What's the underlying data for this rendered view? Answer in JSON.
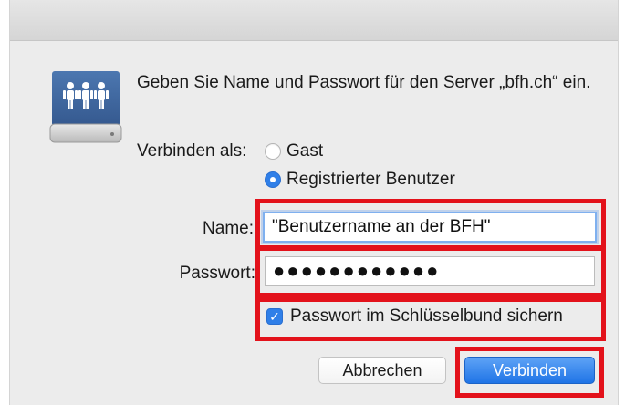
{
  "dialog": {
    "prompt": "Geben Sie Name und Passwort für den Server „bfh.ch“ ein.",
    "connect_as_label": "Verbinden als:",
    "options": {
      "guest": "Gast",
      "registered": "Registrierter Benutzer"
    },
    "selected_option": "registered",
    "name_label": "Name:",
    "name_value": "\"Benutzername an der BFH\"",
    "password_label": "Passwort:",
    "password_value": "●●●●●●●●●●●●",
    "remember_label": "Passwort im Schlüsselbund sichern",
    "remember_checked": true,
    "checkmark": "✓",
    "cancel_label": "Abbrechen",
    "connect_label": "Verbinden"
  },
  "icons": {
    "server": "server-users-icon"
  },
  "colors": {
    "highlight": "#e3121b",
    "accent": "#2f7fe8",
    "dialog_background": "#ececec"
  }
}
